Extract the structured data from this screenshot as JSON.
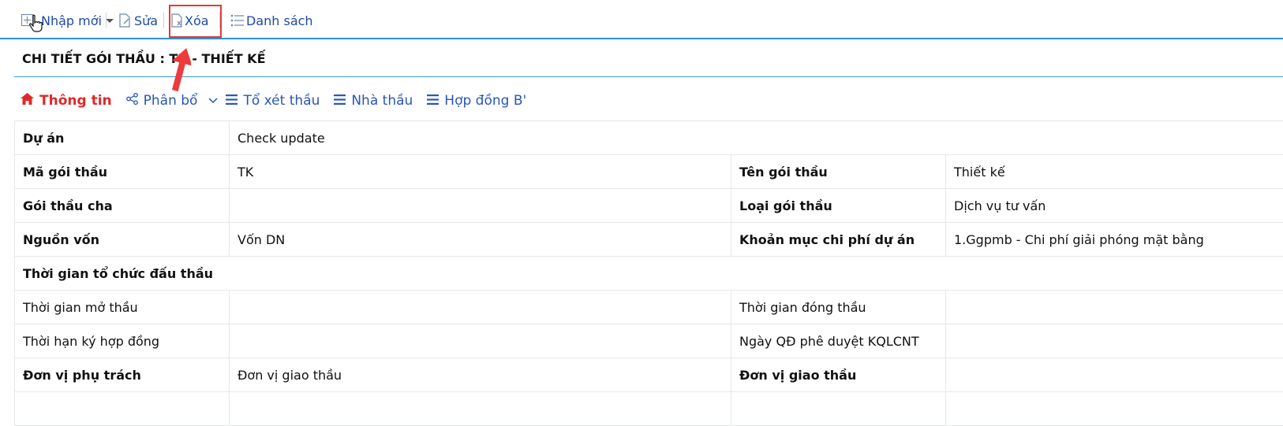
{
  "toolbar": {
    "new_label": "Nhập mới",
    "edit_label": "Sửa",
    "delete_label": "Xóa",
    "list_label": "Danh sách"
  },
  "page_title": "CHI TIẾT GÓI THẦU : TK - THIẾT KẾ",
  "tabs": [
    {
      "label": "Thông tin",
      "icon": "home-icon",
      "active": true
    },
    {
      "label": "Phân bổ",
      "icon": "share-icon"
    },
    {
      "label": "Tổ xét thầu",
      "icon": "list-icon"
    },
    {
      "label": "Nhà thầu",
      "icon": "list-icon"
    },
    {
      "label": "Hợp đồng B'",
      "icon": "list-icon"
    }
  ],
  "details": {
    "project": {
      "label": "Dự án",
      "value": "Check update"
    },
    "package_code": {
      "label": "Mã gói thầu",
      "value": "TK"
    },
    "package_name": {
      "label": "Tên gói thầu",
      "value": "Thiết kế"
    },
    "parent_package": {
      "label": "Gói thầu cha",
      "value": ""
    },
    "package_type": {
      "label": "Loại gói thầu",
      "value": "Dịch vụ tư vấn"
    },
    "funding_source": {
      "label": "Nguồn vốn",
      "value": "Vốn DN"
    },
    "cost_item": {
      "label": "Khoản mục chi phí dự án",
      "value": "1.Ggpmb - Chi phí giải phóng mặt bằng"
    },
    "section_time": "Thời gian tổ chức đấu thầu",
    "open_time": {
      "label": "Thời gian mở thầu",
      "value": ""
    },
    "close_time": {
      "label": "Thời gian đóng thầu",
      "value": ""
    },
    "contract_deadline": {
      "label": "Thời hạn ký hợp đồng",
      "value": ""
    },
    "approval_date": {
      "label": "Ngày QĐ phê duyệt KQLCNT",
      "value": ""
    },
    "responsible_unit": {
      "label": "Đơn vị phụ trách",
      "value": "Đơn vị giao thầu"
    },
    "assigning_unit": {
      "label": "Đơn vị giao thầu",
      "value": ""
    }
  },
  "colors": {
    "accent": "#2f8fd8",
    "link": "#1f4aa8",
    "active_tab": "#e02828",
    "annotation": "#e03a3a"
  }
}
